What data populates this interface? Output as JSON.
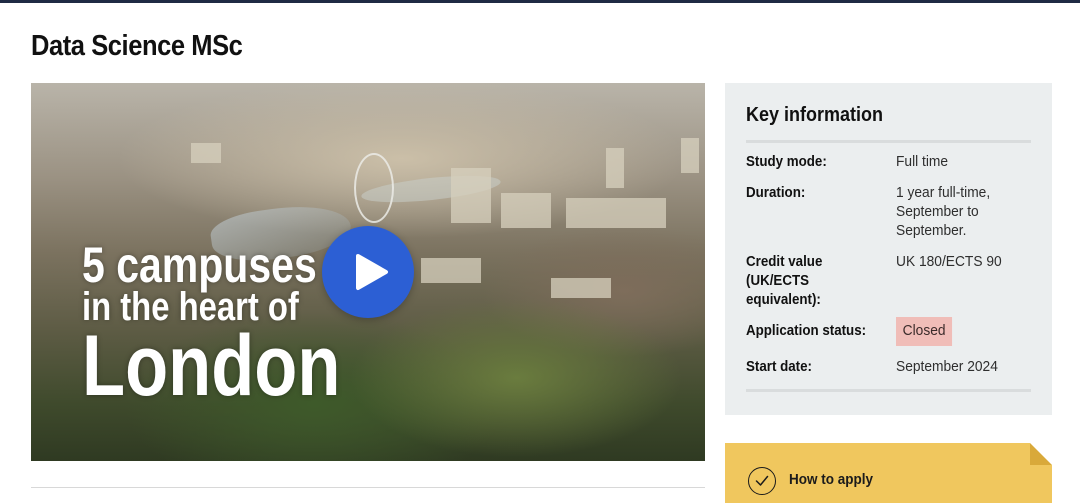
{
  "page": {
    "title": "Data Science MSc"
  },
  "video": {
    "overlay_line1": "5 campuses",
    "overlay_line2": "in the heart of",
    "overlay_line3": "London",
    "play_icon": "play-icon",
    "play_color": "#2c5fd4"
  },
  "key_information": {
    "title": "Key information",
    "rows": [
      {
        "label": "Study mode:",
        "value": "Full time"
      },
      {
        "label": "Duration:",
        "value": "1 year full-time, September to September."
      },
      {
        "label": "Credit value (UK/ECTS equivalent):",
        "value": "UK 180/ECTS 90"
      },
      {
        "label": "Application status:",
        "value": "Closed"
      },
      {
        "label": "Start date:",
        "value": "September 2024"
      }
    ],
    "status_badge_color": "#f0bdb8"
  },
  "apply": {
    "label": "How to apply",
    "icon": "check-circle-icon",
    "color": "#f0c75e"
  }
}
